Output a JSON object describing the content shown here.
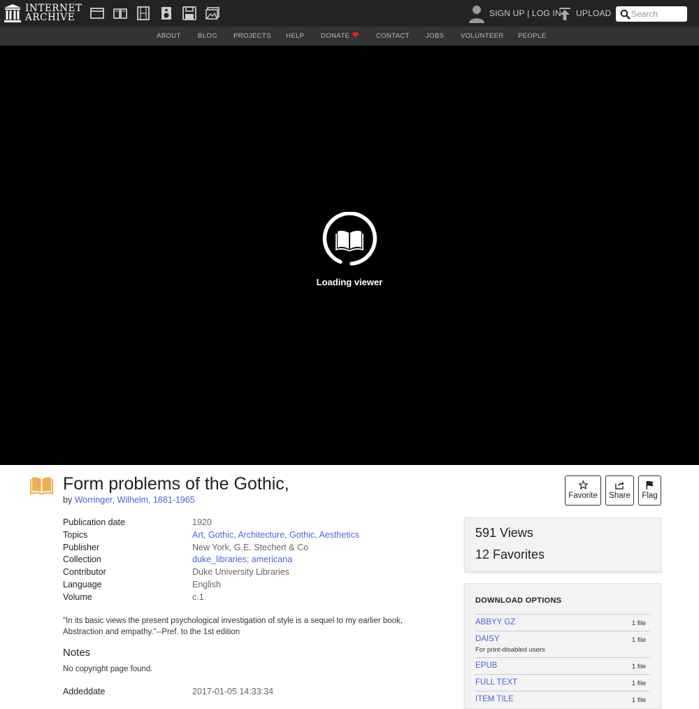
{
  "header": {
    "logo_line1": "INTERNET",
    "logo_line2": "ARCHIVE",
    "media_icons": [
      "web-icon",
      "texts-icon",
      "video-icon",
      "audio-icon",
      "software-icon",
      "images-icon"
    ],
    "signup_label": "SIGN UP",
    "separator": "|",
    "login_label": "LOG IN",
    "upload_label": "UPLOAD",
    "search_placeholder": "Search"
  },
  "subnav": {
    "items": [
      {
        "label": "ABOUT"
      },
      {
        "label": "BLOG"
      },
      {
        "label": "PROJECTS"
      },
      {
        "label": "HELP"
      },
      {
        "label": "DONATE"
      },
      {
        "label": "CONTACT"
      },
      {
        "label": "JOBS"
      },
      {
        "label": "VOLUNTEER"
      },
      {
        "label": "PEOPLE"
      }
    ]
  },
  "viewer": {
    "loading_text": "Loading viewer"
  },
  "item": {
    "title": "Form problems of the Gothic,",
    "by_prefix": "by",
    "author": "Worringer, Wilhelm, 1881-1965",
    "actions": {
      "favorite": "Favorite",
      "share": "Share",
      "flag": "Flag"
    },
    "metadata": {
      "publication_date_label": "Publication date",
      "publication_date": "1920",
      "topics_label": "Topics",
      "topics": [
        "Art",
        "Gothic",
        "Architecture",
        "Gothic",
        "Aesthetics"
      ],
      "topics_separator": ", ",
      "publisher_label": "Publisher",
      "publisher": "New York, G.E. Stechert & Co",
      "collection_label": "Collection",
      "collections": [
        "duke_libraries",
        "americana"
      ],
      "collection_separator": "; ",
      "contributor_label": "Contributor",
      "contributor": "Duke University Libraries",
      "language_label": "Language",
      "language": "English",
      "volume_label": "Volume",
      "volume": "c.1"
    },
    "description": "\"In its basic views the present psychological investigation of style is a sequel to my earlier book, Abstraction and empathy.\"--Pref. to the 1st edition",
    "notes_heading": "Notes",
    "notes_text": "No copyright page found.",
    "addeddate_label": "Addeddate",
    "addeddate": "2017-01-05 14:33:34"
  },
  "stats": {
    "views": "591 Views",
    "favorites": "12 Favorites"
  },
  "downloads": {
    "heading": "DOWNLOAD OPTIONS",
    "items": [
      {
        "name": "ABBYY GZ",
        "count": "1 file",
        "sub": ""
      },
      {
        "name": "DAISY",
        "count": "1 file",
        "sub": "For print-disabled users"
      },
      {
        "name": "EPUB",
        "count": "1 file",
        "sub": ""
      },
      {
        "name": "FULL TEXT",
        "count": "1 file",
        "sub": ""
      },
      {
        "name": "ITEM TILE",
        "count": "1 file",
        "sub": ""
      }
    ]
  },
  "colors": {
    "topbar": "#232323",
    "subnav": "#333333",
    "link": "#4b64de",
    "book_icon": "#f0ad4e",
    "heart": "#e02020"
  }
}
